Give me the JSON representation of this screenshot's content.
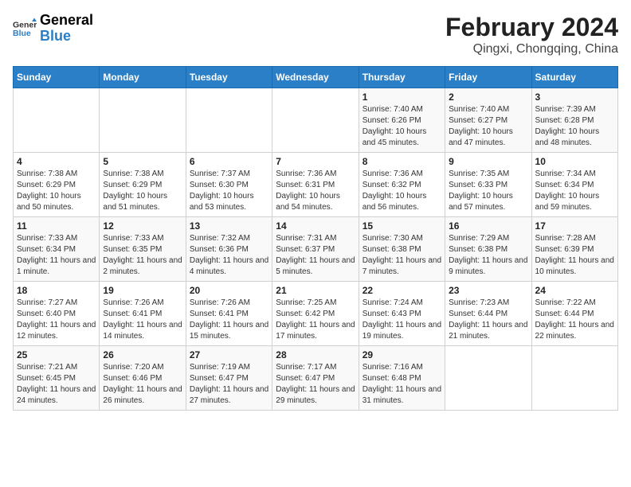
{
  "header": {
    "logo": {
      "general": "General",
      "blue": "Blue"
    },
    "title": "February 2024",
    "subtitle": "Qingxi, Chongqing, China"
  },
  "weekdays": [
    "Sunday",
    "Monday",
    "Tuesday",
    "Wednesday",
    "Thursday",
    "Friday",
    "Saturday"
  ],
  "weeks": [
    [
      {
        "day": "",
        "info": ""
      },
      {
        "day": "",
        "info": ""
      },
      {
        "day": "",
        "info": ""
      },
      {
        "day": "",
        "info": ""
      },
      {
        "day": "1",
        "info": "Sunrise: 7:40 AM\nSunset: 6:26 PM\nDaylight: 10 hours and 45 minutes."
      },
      {
        "day": "2",
        "info": "Sunrise: 7:40 AM\nSunset: 6:27 PM\nDaylight: 10 hours and 47 minutes."
      },
      {
        "day": "3",
        "info": "Sunrise: 7:39 AM\nSunset: 6:28 PM\nDaylight: 10 hours and 48 minutes."
      }
    ],
    [
      {
        "day": "4",
        "info": "Sunrise: 7:38 AM\nSunset: 6:29 PM\nDaylight: 10 hours and 50 minutes."
      },
      {
        "day": "5",
        "info": "Sunrise: 7:38 AM\nSunset: 6:29 PM\nDaylight: 10 hours and 51 minutes."
      },
      {
        "day": "6",
        "info": "Sunrise: 7:37 AM\nSunset: 6:30 PM\nDaylight: 10 hours and 53 minutes."
      },
      {
        "day": "7",
        "info": "Sunrise: 7:36 AM\nSunset: 6:31 PM\nDaylight: 10 hours and 54 minutes."
      },
      {
        "day": "8",
        "info": "Sunrise: 7:36 AM\nSunset: 6:32 PM\nDaylight: 10 hours and 56 minutes."
      },
      {
        "day": "9",
        "info": "Sunrise: 7:35 AM\nSunset: 6:33 PM\nDaylight: 10 hours and 57 minutes."
      },
      {
        "day": "10",
        "info": "Sunrise: 7:34 AM\nSunset: 6:34 PM\nDaylight: 10 hours and 59 minutes."
      }
    ],
    [
      {
        "day": "11",
        "info": "Sunrise: 7:33 AM\nSunset: 6:34 PM\nDaylight: 11 hours and 1 minute."
      },
      {
        "day": "12",
        "info": "Sunrise: 7:33 AM\nSunset: 6:35 PM\nDaylight: 11 hours and 2 minutes."
      },
      {
        "day": "13",
        "info": "Sunrise: 7:32 AM\nSunset: 6:36 PM\nDaylight: 11 hours and 4 minutes."
      },
      {
        "day": "14",
        "info": "Sunrise: 7:31 AM\nSunset: 6:37 PM\nDaylight: 11 hours and 5 minutes."
      },
      {
        "day": "15",
        "info": "Sunrise: 7:30 AM\nSunset: 6:38 PM\nDaylight: 11 hours and 7 minutes."
      },
      {
        "day": "16",
        "info": "Sunrise: 7:29 AM\nSunset: 6:38 PM\nDaylight: 11 hours and 9 minutes."
      },
      {
        "day": "17",
        "info": "Sunrise: 7:28 AM\nSunset: 6:39 PM\nDaylight: 11 hours and 10 minutes."
      }
    ],
    [
      {
        "day": "18",
        "info": "Sunrise: 7:27 AM\nSunset: 6:40 PM\nDaylight: 11 hours and 12 minutes."
      },
      {
        "day": "19",
        "info": "Sunrise: 7:26 AM\nSunset: 6:41 PM\nDaylight: 11 hours and 14 minutes."
      },
      {
        "day": "20",
        "info": "Sunrise: 7:26 AM\nSunset: 6:41 PM\nDaylight: 11 hours and 15 minutes."
      },
      {
        "day": "21",
        "info": "Sunrise: 7:25 AM\nSunset: 6:42 PM\nDaylight: 11 hours and 17 minutes."
      },
      {
        "day": "22",
        "info": "Sunrise: 7:24 AM\nSunset: 6:43 PM\nDaylight: 11 hours and 19 minutes."
      },
      {
        "day": "23",
        "info": "Sunrise: 7:23 AM\nSunset: 6:44 PM\nDaylight: 11 hours and 21 minutes."
      },
      {
        "day": "24",
        "info": "Sunrise: 7:22 AM\nSunset: 6:44 PM\nDaylight: 11 hours and 22 minutes."
      }
    ],
    [
      {
        "day": "25",
        "info": "Sunrise: 7:21 AM\nSunset: 6:45 PM\nDaylight: 11 hours and 24 minutes."
      },
      {
        "day": "26",
        "info": "Sunrise: 7:20 AM\nSunset: 6:46 PM\nDaylight: 11 hours and 26 minutes."
      },
      {
        "day": "27",
        "info": "Sunrise: 7:19 AM\nSunset: 6:47 PM\nDaylight: 11 hours and 27 minutes."
      },
      {
        "day": "28",
        "info": "Sunrise: 7:17 AM\nSunset: 6:47 PM\nDaylight: 11 hours and 29 minutes."
      },
      {
        "day": "29",
        "info": "Sunrise: 7:16 AM\nSunset: 6:48 PM\nDaylight: 11 hours and 31 minutes."
      },
      {
        "day": "",
        "info": ""
      },
      {
        "day": "",
        "info": ""
      }
    ]
  ]
}
